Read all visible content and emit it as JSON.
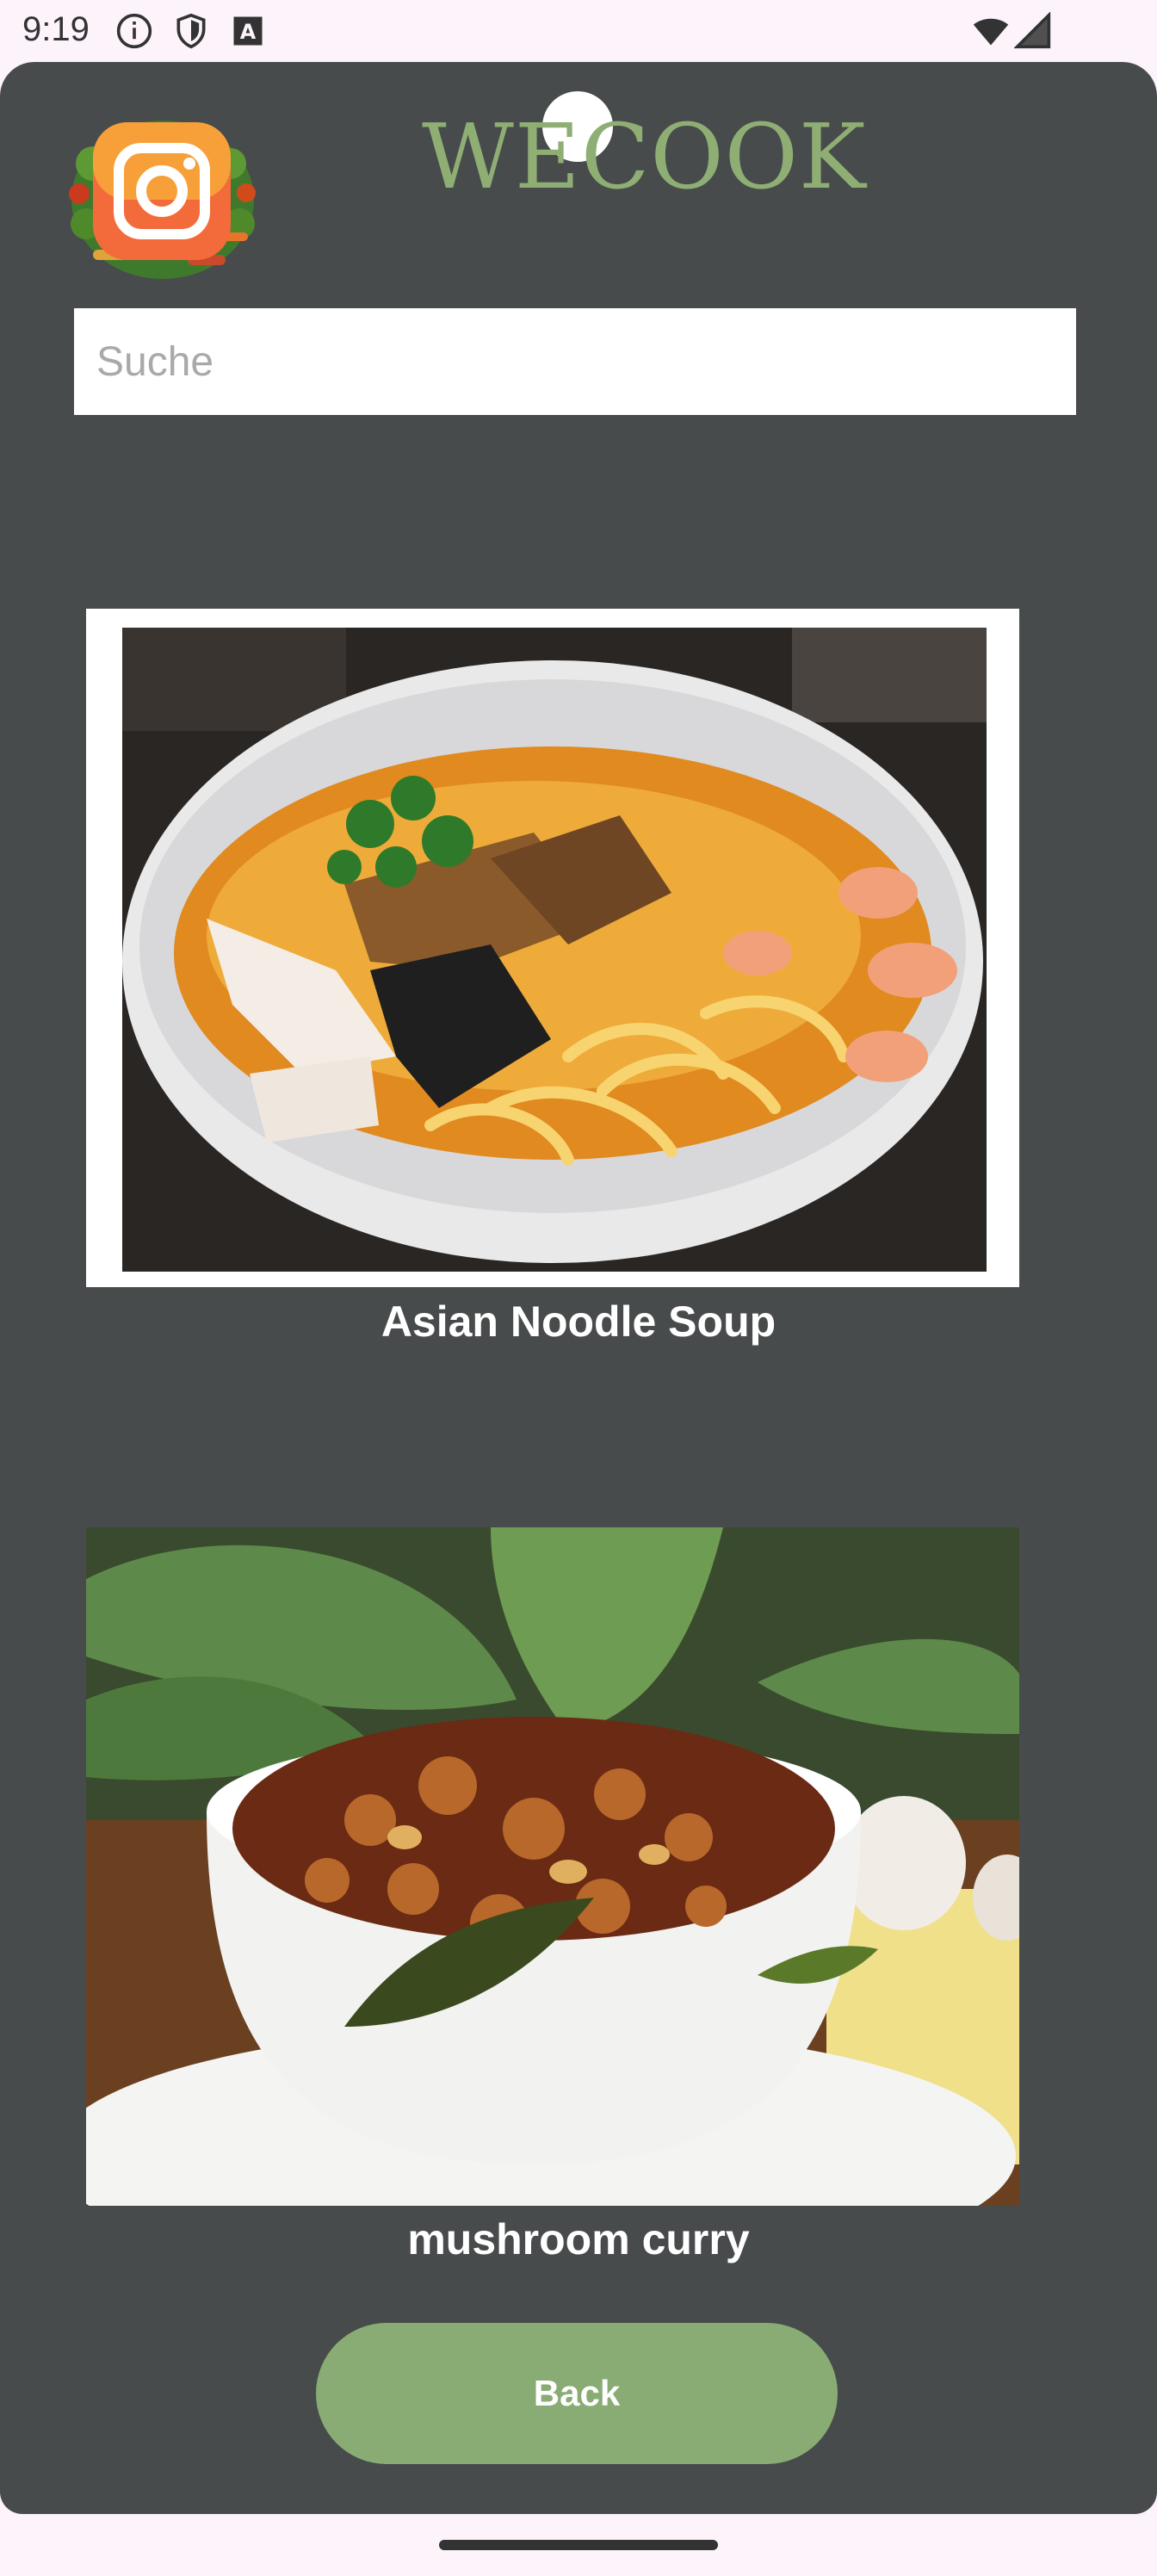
{
  "status_bar": {
    "time": "9:19",
    "left_icons": [
      "info-icon",
      "shield-icon",
      "text-a-icon"
    ],
    "right_icons": [
      "wifi-icon",
      "cell-signal-icon"
    ]
  },
  "header": {
    "app_title": "WECOOK",
    "logo_icon": "wecook-logo-icon"
  },
  "search": {
    "placeholder": "Suche",
    "value": ""
  },
  "recipes": [
    {
      "title": "Asian Noodle Soup",
      "image": "noodle-soup-photo"
    },
    {
      "title": "mushroom curry",
      "image": "mushroom-curry-photo"
    }
  ],
  "footer": {
    "back_label": "Back"
  },
  "colors": {
    "background": "#474b4c",
    "accent_green": "#89ac74",
    "title_green": "#8fae74",
    "system_bar": "#fcf3fb"
  }
}
